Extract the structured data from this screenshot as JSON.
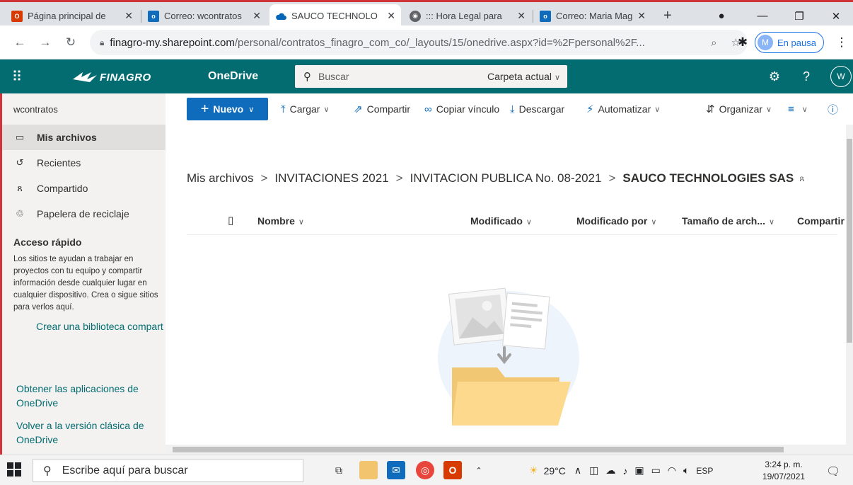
{
  "browser": {
    "tabs": [
      {
        "label": "Página principal de",
        "active": false
      },
      {
        "label": "Correo: wcontratos",
        "active": false
      },
      {
        "label": "SAUCO TECHNOLO",
        "active": true
      },
      {
        "label": "::: Hora Legal para",
        "active": false
      },
      {
        "label": "Correo: Maria Mag",
        "active": false
      }
    ],
    "new_tab": "+",
    "url_host": "finagro-my.sharepoint.com",
    "url_path": "/personal/contratos_finagro_com_co/_layouts/15/onedrive.aspx?id=%2Fpersonal%2F...",
    "profile_initial": "M",
    "profile_status": "En pausa"
  },
  "suite": {
    "brand": "FINAGRO",
    "app_name": "OneDrive",
    "search_placeholder": "Buscar",
    "search_scope": "Carpeta actual",
    "user_initial": "W",
    "accent": "#036c70"
  },
  "nav": {
    "account": "wcontratos",
    "items": [
      {
        "label": "Mis archivos",
        "icon": "folder-icon",
        "selected": true
      },
      {
        "label": "Recientes",
        "icon": "clock-icon",
        "selected": false
      },
      {
        "label": "Compartido",
        "icon": "shared-people-icon",
        "selected": false
      },
      {
        "label": "Papelera de reciclaje",
        "icon": "recycle-bin-icon",
        "selected": false
      }
    ],
    "quick_access_title": "Acceso rápido",
    "quick_access_desc": "Los sitios te ayudan a trabajar en proyectos con tu equipo y compartir información desde cualquier lugar en cualquier dispositivo. Crea o sigue sitios para verlos aquí.",
    "create_library": "Crear una biblioteca compart",
    "get_apps": "Obtener las aplicaciones de OneDrive",
    "classic": "Volver a la versión clásica de OneDrive"
  },
  "commands": {
    "new": "Nuevo",
    "upload": "Cargar",
    "share": "Compartir",
    "copy_link": "Copiar vínculo",
    "download": "Descargar",
    "automate": "Automatizar",
    "sort": "Organizar"
  },
  "breadcrumb": {
    "items": [
      "Mis archivos",
      "INVITACIONES 2021",
      "INVITACION PUBLICA No. 08-2021"
    ],
    "current": "SAUCO TECHNOLOGIES SAS"
  },
  "list": {
    "columns": {
      "name": "Nombre",
      "modified": "Modificado",
      "modified_by": "Modificado por",
      "size": "Tamaño de arch...",
      "sharing": "Compartir"
    },
    "rows": []
  },
  "taskbar": {
    "search_placeholder": "Escribe aquí para buscar",
    "temperature": "29°C",
    "language": "ESP",
    "time": "3:24 p. m.",
    "date": "19/07/2021"
  }
}
